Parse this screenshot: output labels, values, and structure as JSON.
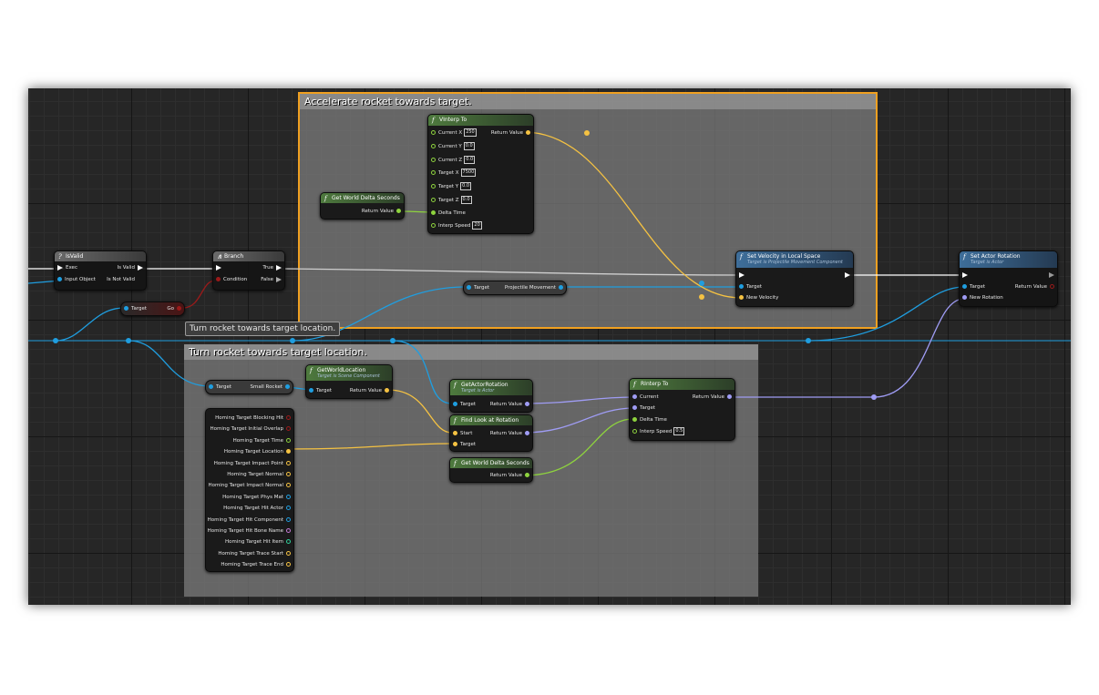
{
  "colors": {
    "exec": "#ffffff",
    "object": "#1f9ee0",
    "float": "#8ed33e",
    "vector": "#f5c242",
    "rotator": "#9f9cf4",
    "bool": "#9b1a1a",
    "struct": "#d0d0d0"
  },
  "comments": {
    "accelerate": "Accelerate rocket towards target.",
    "turn": "Turn rocket towards target location.",
    "turn_tooltip": "Turn rocket towards target location."
  },
  "isvalid": {
    "title": "IsValid",
    "exec": "Exec",
    "input": "Input Object",
    "is_valid": "Is Valid",
    "is_not_valid": "Is Not Valid",
    "icon": "question-icon"
  },
  "branch": {
    "title": "Branch",
    "condition": "Condition",
    "true": "True",
    "false": "False",
    "icon": "branch-icon"
  },
  "target_go": {
    "target": "Target",
    "go": "Go"
  },
  "vinterp": {
    "title": "VInterp To",
    "current_x": "Current X",
    "current_x_val": "250",
    "current_y": "Current Y",
    "current_y_val": "0.0",
    "current_z": "Current Z",
    "current_z_val": "0.0",
    "target_x": "Target X",
    "target_x_val": "7500",
    "target_y": "Target Y",
    "target_y_val": "0.0",
    "target_z": "Target Z",
    "target_z_val": "0.0",
    "delta_time": "Delta Time",
    "interp_speed": "Interp Speed",
    "interp_speed_val": "20",
    "return_value": "Return Value"
  },
  "world_delta_1": {
    "title": "Get World Delta Seconds",
    "return_value": "Return Value"
  },
  "projectile": {
    "target": "Target",
    "label": "Projectile Movement"
  },
  "set_velocity": {
    "title": "Set Velocity in Local Space",
    "subtitle": "Target is Projectile Movement Component",
    "target": "Target",
    "new_velocity": "New Velocity"
  },
  "set_rotation": {
    "title": "Set Actor Rotation",
    "subtitle": "Target is Actor",
    "target": "Target",
    "new_rotation": "New Rotation",
    "return_value": "Return Value"
  },
  "small_rocket": {
    "target": "Target",
    "label": "Small Rocket"
  },
  "get_world_location": {
    "title": "GetWorldLocation",
    "subtitle": "Target is Scene Component",
    "target": "Target",
    "return_value": "Return Value"
  },
  "get_actor_rotation": {
    "title": "GetActorRotation",
    "subtitle": "Target is Actor",
    "target": "Target",
    "return_value": "Return Value"
  },
  "find_look": {
    "title": "Find Look at Rotation",
    "start": "Start",
    "target": "Target",
    "return_value": "Return Value"
  },
  "world_delta_2": {
    "title": "Get World Delta Seconds",
    "return_value": "Return Value"
  },
  "rinterp": {
    "title": "RInterp To",
    "current": "Current",
    "target": "Target",
    "delta_time": "Delta Time",
    "interp_speed": "Interp Speed",
    "interp_speed_val": "0.5",
    "return_value": "Return Value"
  },
  "break_hit": {
    "items": [
      {
        "label": "Homing Target Blocking Hit",
        "type": "bool"
      },
      {
        "label": "Homing Target Initial Overlap",
        "type": "bool"
      },
      {
        "label": "Homing Target Time",
        "type": "float"
      },
      {
        "label": "Homing Target Location",
        "type": "vector"
      },
      {
        "label": "Homing Target Impact Point",
        "type": "vector"
      },
      {
        "label": "Homing Target Normal",
        "type": "vector"
      },
      {
        "label": "Homing Target Impact Normal",
        "type": "vector"
      },
      {
        "label": "Homing Target Phys Mat",
        "type": "object"
      },
      {
        "label": "Homing Target Hit Actor",
        "type": "object"
      },
      {
        "label": "Homing Target Hit Component",
        "type": "object"
      },
      {
        "label": "Homing Target Hit Bone Name",
        "type": "name"
      },
      {
        "label": "Homing Target Hit Item",
        "type": "int"
      },
      {
        "label": "Homing Target Trace Start",
        "type": "vector"
      },
      {
        "label": "Homing Target Trace End",
        "type": "vector"
      }
    ]
  }
}
